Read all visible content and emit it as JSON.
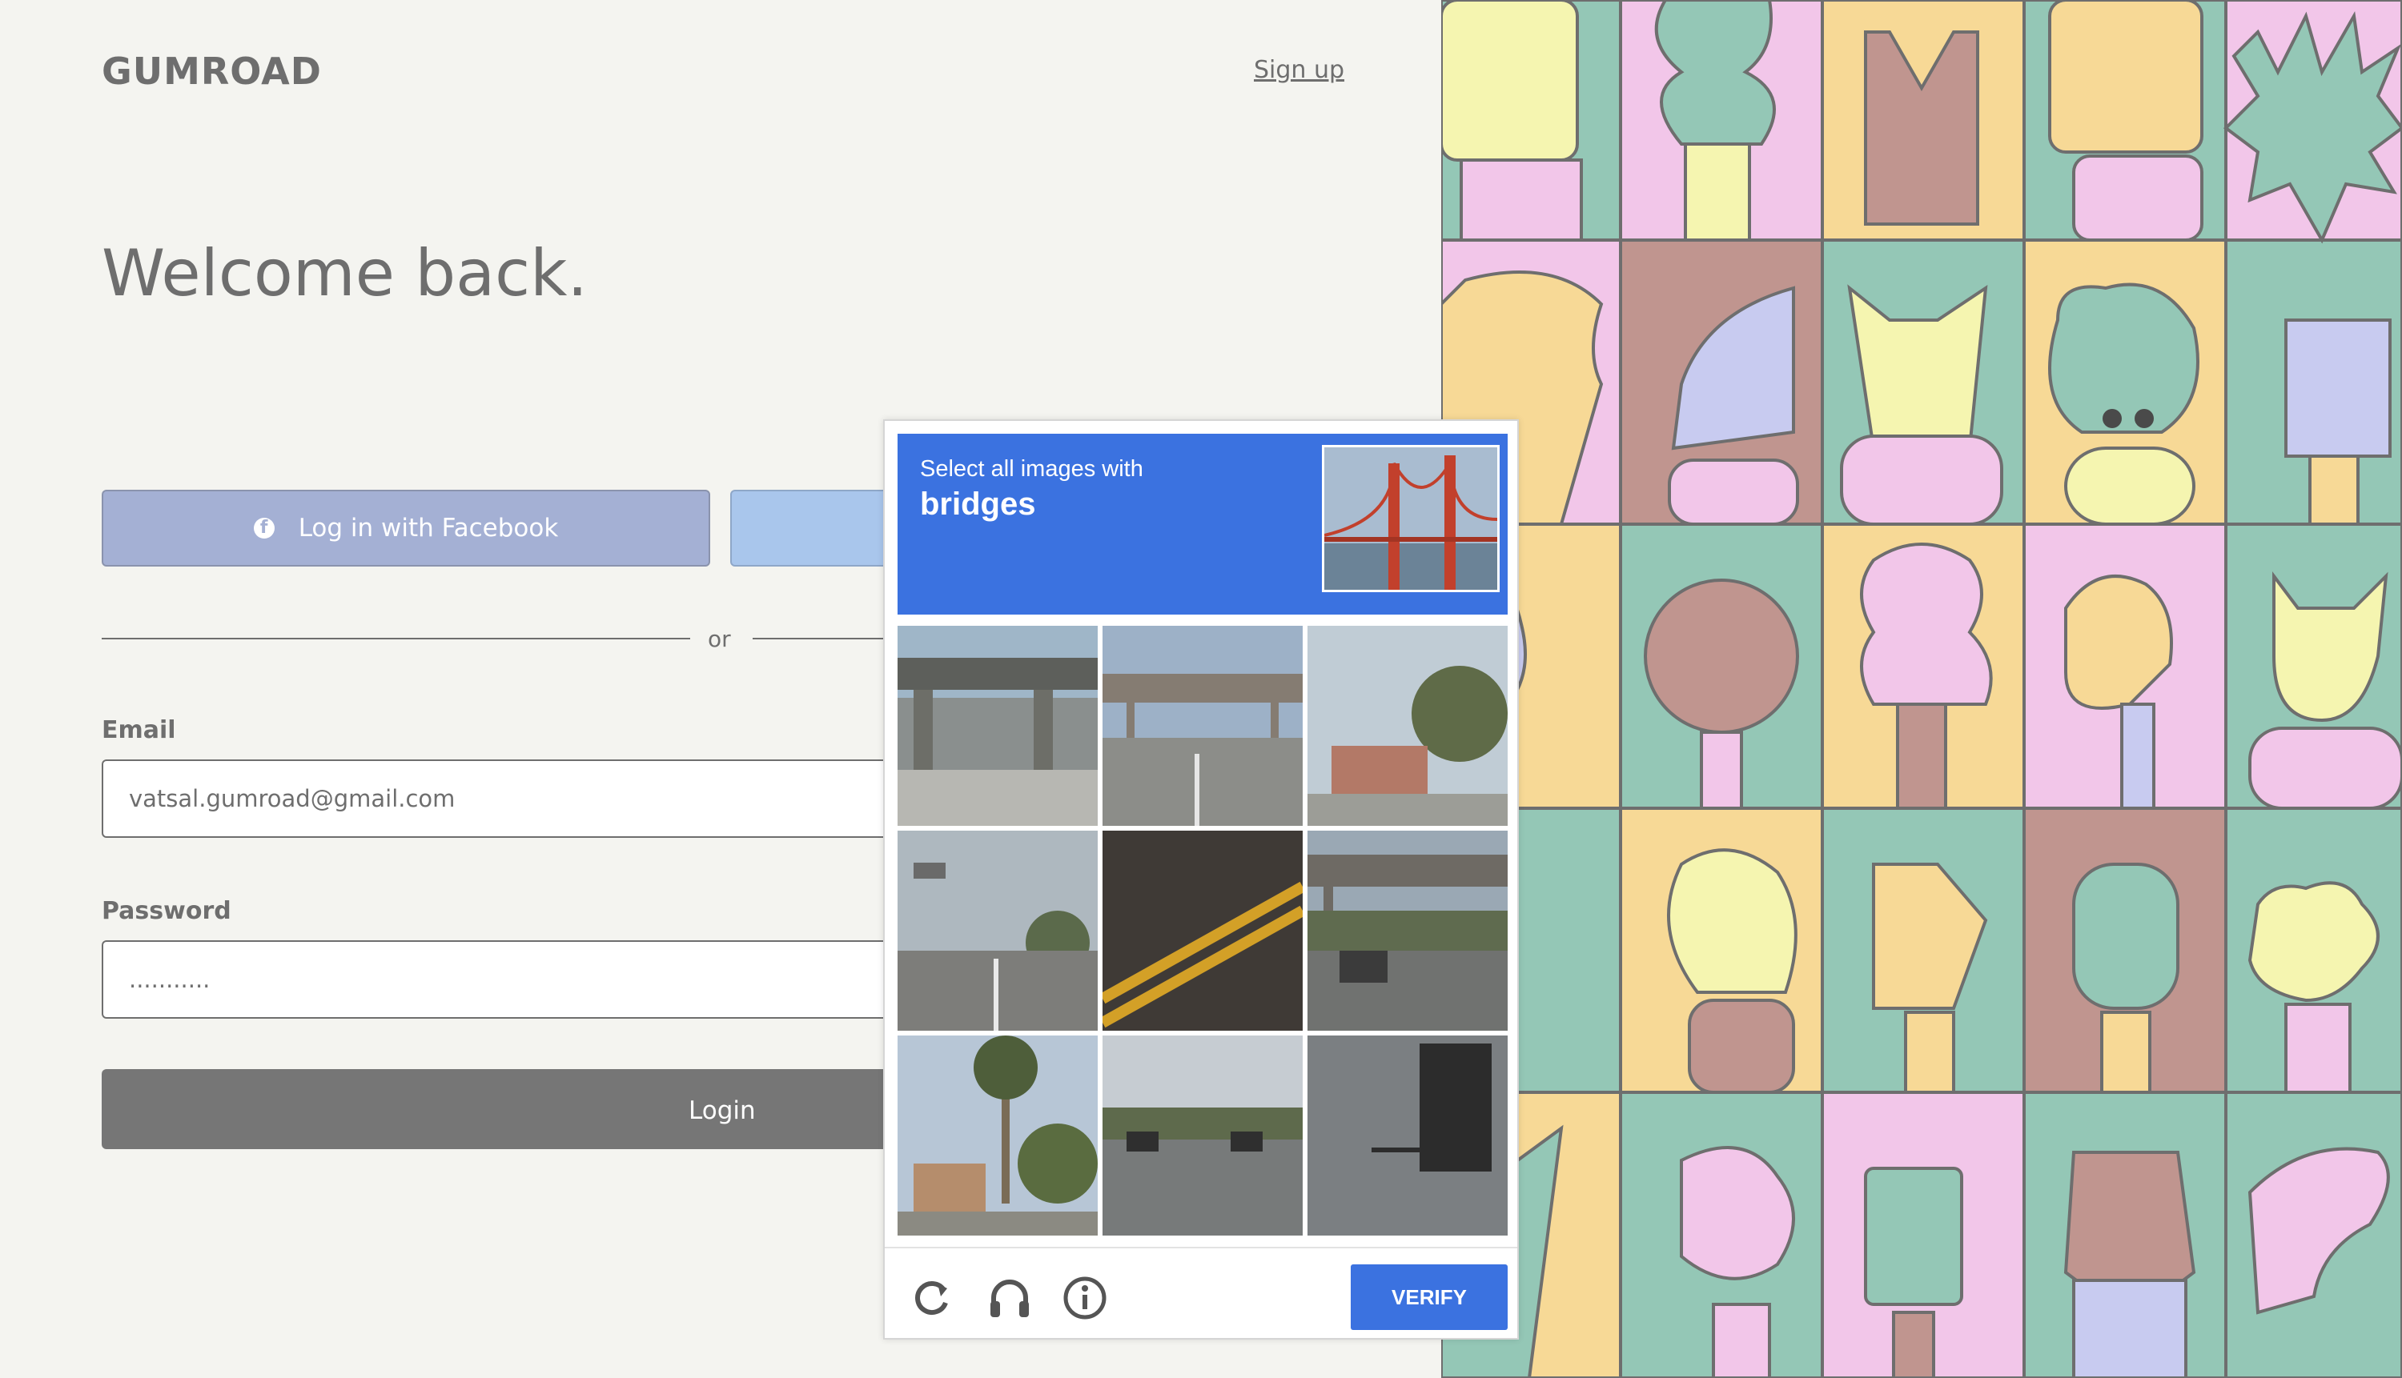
{
  "brand": {
    "logo": "GUMROAD"
  },
  "header": {
    "signup_label": "Sign up"
  },
  "main": {
    "title": "Welcome back.",
    "facebook_label": "Log in with Facebook",
    "divider_text": "or",
    "email_label": "Email",
    "email_value": "vatsal.gumroad@gmail.com",
    "password_label": "Password",
    "password_value": "...........",
    "login_label": "Login"
  },
  "captcha": {
    "instruction": "Select all images with",
    "target": "bridges",
    "verify_label": "VERIFY",
    "icons": [
      "reload-icon",
      "audio-headphones-icon",
      "info-icon"
    ],
    "tiles": [
      "highway-overpass",
      "road-overpass",
      "street-trees",
      "road-signs",
      "road-yellow-lines",
      "highway-bridge",
      "palm-street",
      "traffic-road",
      "dark-sign"
    ]
  },
  "colors": {
    "captcha_blue": "#3b72e0",
    "facebook_button": "#a4b0d4",
    "login_button": "#767676",
    "text_gray": "#6e6e6e"
  }
}
